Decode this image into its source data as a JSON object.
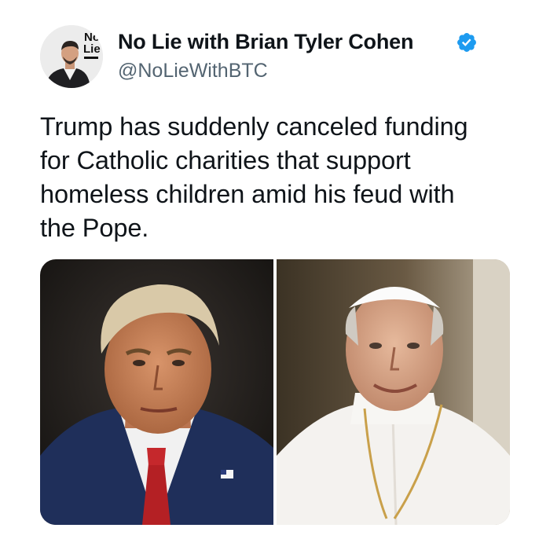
{
  "account": {
    "display_name": "No Lie with Brian Tyler Cohen",
    "handle": "@NoLieWithBTC",
    "verified": true,
    "avatar_logo_line1": "No",
    "avatar_logo_line2": "Lie"
  },
  "tweet": {
    "text_lines": [
      "Trump has suddenly canceled funding",
      "for Catholic charities that support",
      "homeless children amid his feud with",
      "the Pope."
    ]
  },
  "media": {
    "photo_count": 2
  },
  "colors": {
    "verified_badge": "#1d9bf0",
    "handle_text": "#536471",
    "body_text": "#0f1419"
  }
}
